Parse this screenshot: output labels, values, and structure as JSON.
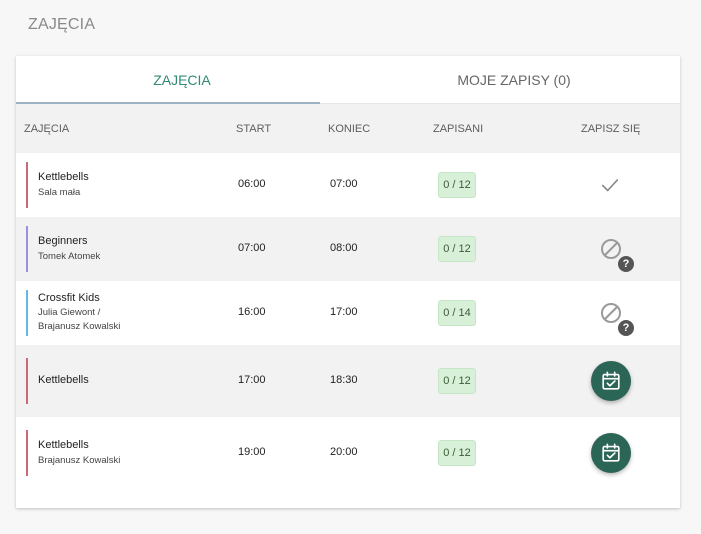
{
  "page": {
    "title": "ZAJĘCIA"
  },
  "tabs": [
    {
      "label": "ZAJĘCIA",
      "active": true
    },
    {
      "label": "MOJE ZAPISY (0)",
      "active": false
    }
  ],
  "table": {
    "headers": {
      "name": "ZAJĘCIA",
      "start": "START",
      "end": "KONIEC",
      "enrolled": "ZAPISANI",
      "signup": "ZAPISZ SIĘ"
    },
    "rows": [
      {
        "name": "Kettlebells",
        "sub": [
          "Sala mała"
        ],
        "start": "06:00",
        "end": "07:00",
        "enrolled": "0 / 12",
        "color": "#c96a78",
        "action": "check-icon"
      },
      {
        "name": "Beginners",
        "sub": [
          "Tomek Atomek"
        ],
        "start": "07:00",
        "end": "08:00",
        "enrolled": "0 / 12",
        "color": "#9a8fe0",
        "action": "blocked-icon"
      },
      {
        "name": "Crossfit Kids",
        "sub": [
          "Julia Giewont /",
          "Brajanusz Kowalski"
        ],
        "start": "16:00",
        "end": "17:00",
        "enrolled": "0 / 14",
        "color": "#62b9e6",
        "action": "blocked-icon"
      },
      {
        "name": "Kettlebells",
        "sub": [],
        "start": "17:00",
        "end": "18:30",
        "enrolled": "0 / 12",
        "color": "#c96a78",
        "action": "calendar-check-icon"
      },
      {
        "name": "Kettlebells",
        "sub": [
          "Brajanusz Kowalski"
        ],
        "start": "19:00",
        "end": "20:00",
        "enrolled": "0 / 12",
        "color": "#c96a78",
        "action": "calendar-check-icon"
      }
    ]
  },
  "colors": {
    "accent": "#2f8a76",
    "fab": "#2b6555",
    "badge_bg": "#d8f0d8"
  }
}
